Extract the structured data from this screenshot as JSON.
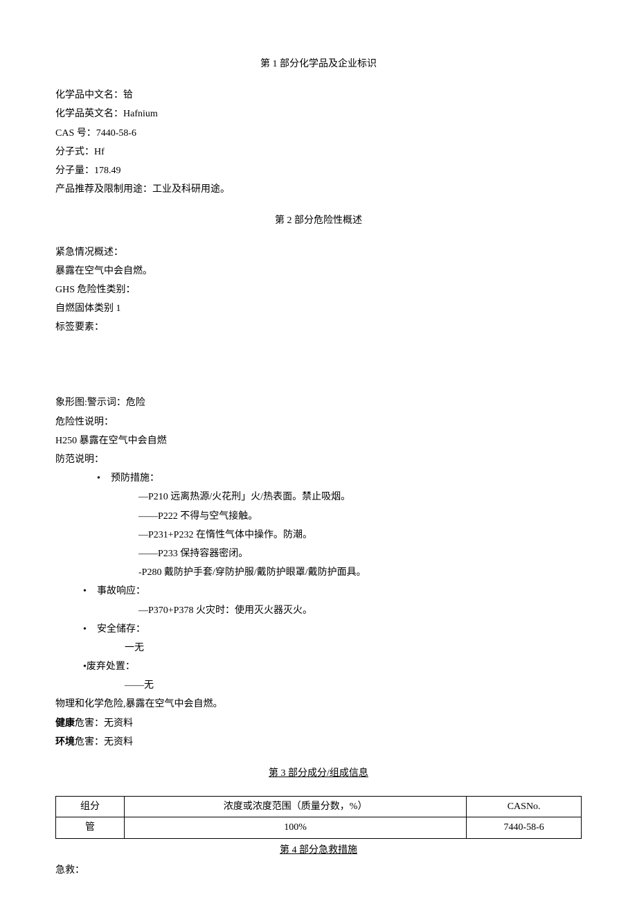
{
  "section1": {
    "title": "第 1 部分化学品及企业标识",
    "labels": {
      "zh_name": "化学品中文名：",
      "en_name": "化学品英文名：",
      "cas": "CAS 号：",
      "formula": "分子式：",
      "mw": "分子量：",
      "use": "产品推荐及限制用途："
    },
    "values": {
      "zh_name": "铪",
      "en_name": "Hafnium",
      "cas": "7440-58-6",
      "formula": "Hf",
      "mw": "178.49",
      "use": "工业及科研用途。"
    }
  },
  "section2": {
    "title": "第 2 部分危险性概述",
    "emergency_label": "紧急情况概述：",
    "emergency_text": "暴露在空气中会自燃。",
    "ghs_label": "GHS 危险性类别：",
    "ghs_text": "自燃固体类别 1",
    "label_elements": "标签要素：",
    "pictogram": "象形图:警示词：危险",
    "hazard_label": "危险性说明：",
    "hazard_text": "H250 暴露在空气中会自燃",
    "precaution_label": "防范说明：",
    "prevention": {
      "title": "预防措施：",
      "items": [
        "—P210 远离热源/火花刑」火/热表面。禁止吸烟。",
        "——P222 不得与空气接触。",
        "—P231+P232 在惰性气体中操作。防潮。",
        "——P233 保持容器密闭。",
        "-P280 戴防护手套/穿防护服/戴防护眼罩/戴防护面具。"
      ]
    },
    "response": {
      "title": "事故响应：",
      "items": [
        "—P370+P378 火灾时：使用灭火器灭火。"
      ]
    },
    "storage": {
      "title": "安全储存：",
      "items": [
        "一无"
      ]
    },
    "disposal": {
      "title": "•废弃处置：",
      "items": [
        "——无"
      ]
    },
    "phys_chem": "物理和化学危险,暴露在空气中会自燃。",
    "health_label": "健康",
    "health_text": "危害：无资料",
    "env_label": "环境",
    "env_text": "危害：无资料"
  },
  "section3": {
    "title": "第 3 部分成分/组成信息",
    "headers": [
      "组分",
      "浓度或浓度范围（质量分数，%）",
      "CASNo."
    ],
    "row": [
      "管",
      "100%",
      "7440-58-6"
    ]
  },
  "section4": {
    "title": "第 4 部分急救措施",
    "label": "急救："
  }
}
